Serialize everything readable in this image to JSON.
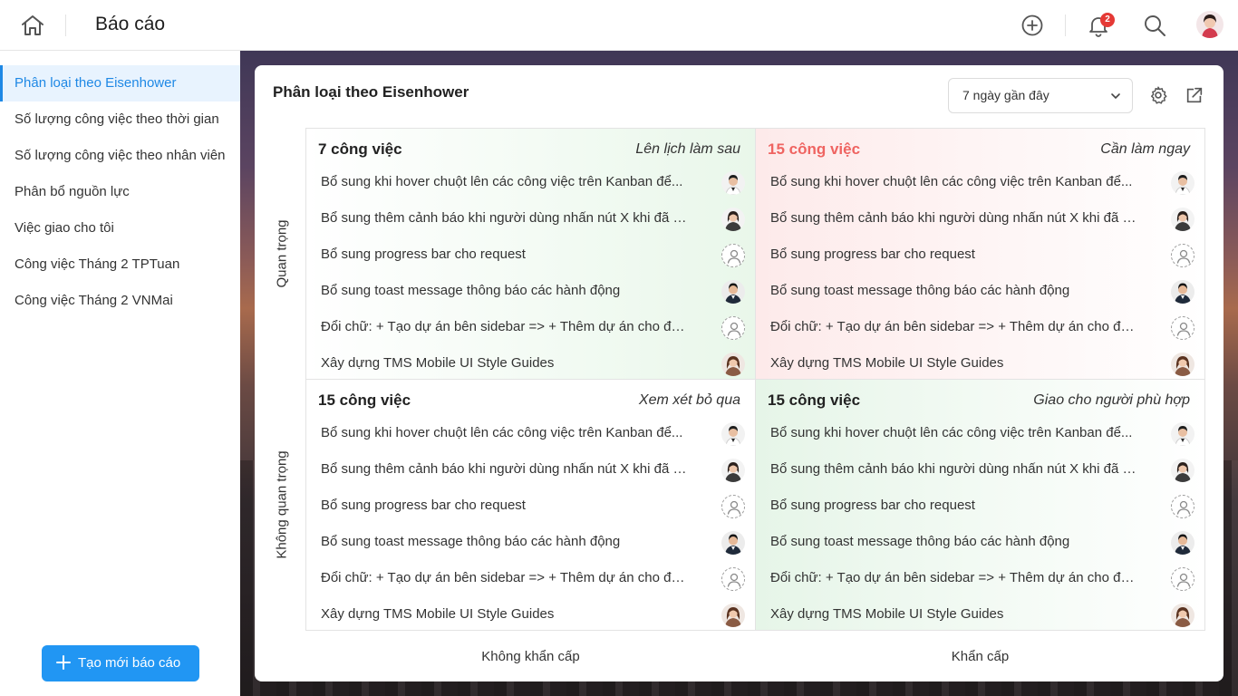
{
  "header": {
    "title": "Báo cáo",
    "notification_count": "2",
    "icons": [
      "home-icon",
      "plus-circle-icon",
      "bell-icon",
      "search-icon",
      "avatar"
    ]
  },
  "sidebar": {
    "items": [
      {
        "label": "Phân loại theo Eisenhower",
        "active": true
      },
      {
        "label": "Số lượng công việc theo thời gian"
      },
      {
        "label": "Số lượng công việc theo nhân viên"
      },
      {
        "label": "Phân bổ nguồn lực"
      },
      {
        "label": "Việc giao cho tôi"
      },
      {
        "label": "Công việc Tháng 2 TPTuan"
      },
      {
        "label": "Công việc Tháng 2 VNMai"
      }
    ],
    "create_button": "Tạo mới báo cáo"
  },
  "card": {
    "title": "Phân loại theo Eisenhower",
    "range": "7 ngày gần đây",
    "axis_y_top": "Quan trọng",
    "axis_y_bottom": "Không quan trọng",
    "axis_x_left": "Không khẩn cấp",
    "axis_x_right": "Khẩn cấp"
  },
  "colors": {
    "accent": "#2196f3",
    "urgent_count": "#ef6461",
    "green_tint": "#e9f7ea",
    "red_tint": "#fdeaea"
  },
  "quadrants": {
    "tl": {
      "count": "7 công việc",
      "label": "Lên lịch làm sau",
      "tasks": [
        {
          "name": "Bổ sung khi hover chuột lên các công việc trên Kanban để...",
          "avatar": "male-avatar"
        },
        {
          "name": "Bổ sung thêm cảnh báo khi người dùng nhấn nút X khi đã t...",
          "avatar": "female-avatar"
        },
        {
          "name": "Bổ sung progress bar cho request",
          "avatar": "empty-avatar"
        },
        {
          "name": "Bổ sung toast message thông báo các hành động",
          "avatar": "male-avatar-2"
        },
        {
          "name": "Đổi chữ: + Tạo dự án bên sidebar => + Thêm dự án cho đồ...",
          "avatar": "empty-avatar"
        },
        {
          "name": "Xây dựng TMS  Mobile  UI  Style  Guides",
          "avatar": "female-avatar-2"
        }
      ]
    },
    "tr": {
      "count": "15 công việc",
      "label": "Cần làm ngay",
      "tasks": [
        {
          "name": "Bổ sung khi hover chuột lên các công việc trên Kanban để...",
          "avatar": "male-avatar"
        },
        {
          "name": "Bổ sung thêm cảnh báo khi người dùng nhấn nút X khi đã t...",
          "avatar": "female-avatar"
        },
        {
          "name": "Bổ sung progress bar cho request",
          "avatar": "empty-avatar"
        },
        {
          "name": "Bổ sung toast message thông báo các hành động",
          "avatar": "male-avatar-2"
        },
        {
          "name": "Đổi chữ: + Tạo dự án bên sidebar => + Thêm dự án cho đồ...",
          "avatar": "empty-avatar"
        },
        {
          "name": "Xây dựng TMS  Mobile  UI  Style  Guides",
          "avatar": "female-avatar-2"
        }
      ]
    },
    "bl": {
      "count": "15 công việc",
      "label": "Xem xét bỏ qua",
      "tasks": [
        {
          "name": "Bổ sung khi hover chuột lên các công việc trên Kanban để...",
          "avatar": "male-avatar"
        },
        {
          "name": "Bổ sung thêm cảnh báo khi người dùng nhấn nút X khi đã t...",
          "avatar": "female-avatar"
        },
        {
          "name": "Bổ sung progress bar cho request",
          "avatar": "empty-avatar"
        },
        {
          "name": "Bổ sung toast message thông báo các hành động",
          "avatar": "male-avatar-2"
        },
        {
          "name": "Đổi chữ: + Tạo dự án bên sidebar => + Thêm dự án cho đồ...",
          "avatar": "empty-avatar"
        },
        {
          "name": "Xây dựng TMS  Mobile  UI  Style  Guides",
          "avatar": "female-avatar-2"
        }
      ]
    },
    "br": {
      "count": "15 công việc",
      "label": "Giao cho người phù hợp",
      "tasks": [
        {
          "name": "Bổ sung khi hover chuột lên các công việc trên Kanban để...",
          "avatar": "male-avatar"
        },
        {
          "name": "Bổ sung thêm cảnh báo khi người dùng nhấn nút X khi đã t...",
          "avatar": "female-avatar"
        },
        {
          "name": "Bổ sung progress bar cho request",
          "avatar": "empty-avatar"
        },
        {
          "name": "Bổ sung toast message thông báo các hành động",
          "avatar": "male-avatar-2"
        },
        {
          "name": "Đổi chữ: + Tạo dự án bên sidebar => + Thêm dự án cho đồ...",
          "avatar": "empty-avatar"
        },
        {
          "name": "Xây dựng TMS  Mobile  UI  Style  Guides",
          "avatar": "female-avatar-2"
        }
      ]
    }
  }
}
